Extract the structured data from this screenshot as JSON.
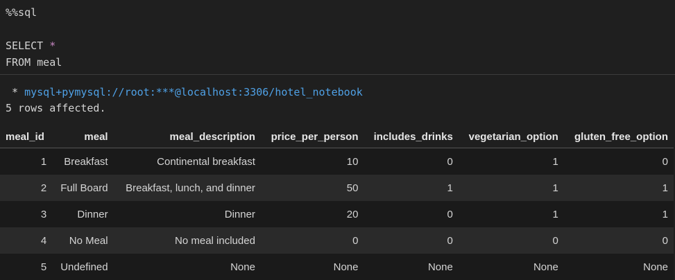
{
  "code": {
    "magic": "%%sql",
    "line_select": "SELECT ",
    "select_star": "*",
    "line_from": "FROM meal"
  },
  "output": {
    "conn_prefix": " * ",
    "connection": "mysql+pymysql://root:***@localhost:3306/hotel_notebook",
    "rows_affected": "5 rows affected."
  },
  "table": {
    "headers": [
      "meal_id",
      "meal",
      "meal_description",
      "price_per_person",
      "includes_drinks",
      "vegetarian_option",
      "gluten_free_option"
    ],
    "rows": [
      [
        "1",
        "Breakfast",
        "Continental breakfast",
        "10",
        "0",
        "1",
        "0"
      ],
      [
        "2",
        "Full Board",
        "Breakfast, lunch, and dinner",
        "50",
        "1",
        "1",
        "1"
      ],
      [
        "3",
        "Dinner",
        "Dinner",
        "20",
        "0",
        "1",
        "1"
      ],
      [
        "4",
        "No Meal",
        "No meal included",
        "0",
        "0",
        "0",
        "0"
      ],
      [
        "5",
        "Undefined",
        "None",
        "None",
        "None",
        "None",
        "None"
      ]
    ]
  }
}
